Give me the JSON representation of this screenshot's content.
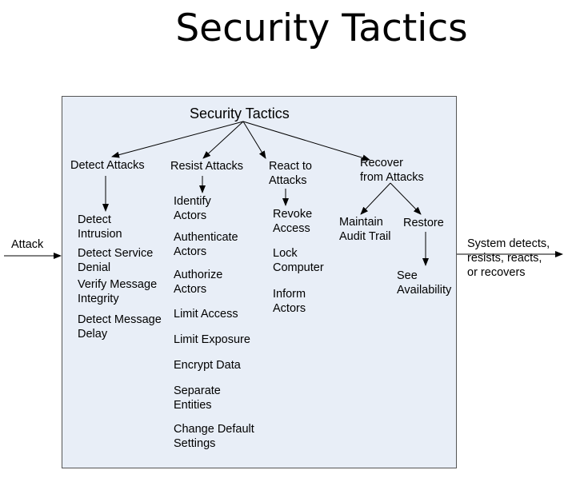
{
  "slide_title": "Security Tactics",
  "diagram": {
    "root": "Security Tactics",
    "input": "Attack",
    "output": "System detects,\nresists, reacts,\nor recovers",
    "categories": {
      "detect": "Detect Attacks",
      "resist": "Resist Attacks",
      "react": "React to\nAttacks",
      "recover": "Recover\nfrom Attacks"
    },
    "detect_items": [
      "Detect\nIntrusion",
      "Detect Service\nDenial",
      "Verify Message\nIntegrity",
      "Detect Message\nDelay"
    ],
    "resist_items": [
      "Identify\nActors",
      "Authenticate\nActors",
      "Authorize\nActors",
      "Limit Access",
      "Limit Exposure",
      "Encrypt Data",
      "Separate\nEntities",
      "Change Default\nSettings"
    ],
    "react_items": [
      "Revoke\nAccess",
      "Lock\nComputer",
      "Inform\nActors"
    ],
    "recover_items": {
      "maintain": "Maintain\nAudit Trail",
      "restore": "Restore",
      "see": "See\nAvailability"
    }
  }
}
